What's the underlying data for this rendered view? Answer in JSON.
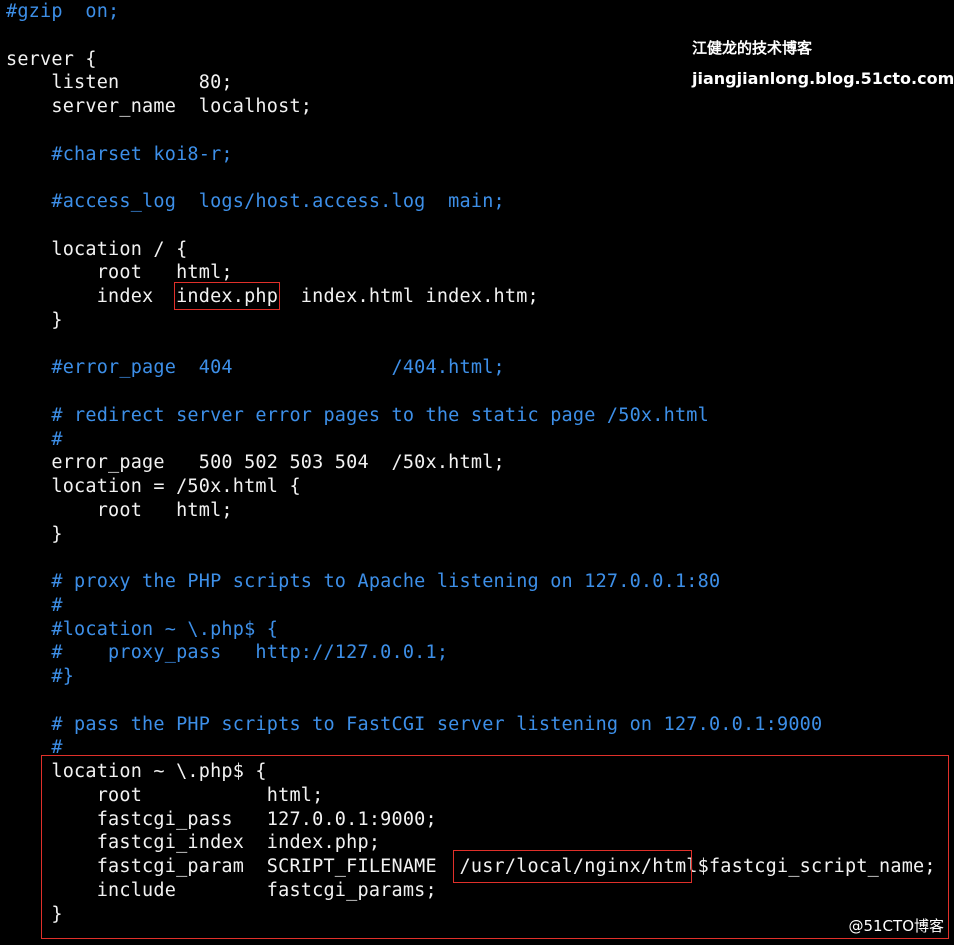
{
  "colors": {
    "background": "#000000",
    "code_text": "#f2f2f2",
    "comment_text": "#3d8fe8",
    "highlight_border": "#e0302a"
  },
  "watermark": {
    "title": "江健龙的技术博客",
    "url": "jiangjianlong.blog.51cto.com",
    "corner": "@51CTO博客"
  },
  "lines": [
    {
      "text": "#gzip  on;",
      "kind": "comment"
    },
    {
      "text": "",
      "kind": "code"
    },
    {
      "text": "server {",
      "kind": "code"
    },
    {
      "text": "    listen       80;",
      "kind": "code"
    },
    {
      "text": "    server_name  localhost;",
      "kind": "code"
    },
    {
      "text": "",
      "kind": "code"
    },
    {
      "text": "    #charset koi8-r;",
      "kind": "comment"
    },
    {
      "text": "",
      "kind": "code"
    },
    {
      "text": "    #access_log  logs/host.access.log  main;",
      "kind": "comment"
    },
    {
      "text": "",
      "kind": "code"
    },
    {
      "text": "    location / {",
      "kind": "code"
    },
    {
      "text": "        root   html;",
      "kind": "code"
    },
    {
      "text": "        index  index.php  index.html index.htm;",
      "kind": "code"
    },
    {
      "text": "    }",
      "kind": "code"
    },
    {
      "text": "",
      "kind": "code"
    },
    {
      "text": "    #error_page  404              /404.html;",
      "kind": "comment"
    },
    {
      "text": "",
      "kind": "code"
    },
    {
      "text": "    # redirect server error pages to the static page /50x.html",
      "kind": "comment"
    },
    {
      "text": "    #",
      "kind": "comment"
    },
    {
      "text": "    error_page   500 502 503 504  /50x.html;",
      "kind": "code"
    },
    {
      "text": "    location = /50x.html {",
      "kind": "code"
    },
    {
      "text": "        root   html;",
      "kind": "code"
    },
    {
      "text": "    }",
      "kind": "code"
    },
    {
      "text": "",
      "kind": "code"
    },
    {
      "text": "    # proxy the PHP scripts to Apache listening on 127.0.0.1:80",
      "kind": "comment"
    },
    {
      "text": "    #",
      "kind": "comment"
    },
    {
      "text": "    #location ~ \\.php$ {",
      "kind": "comment"
    },
    {
      "text": "    #    proxy_pass   http://127.0.0.1;",
      "kind": "comment"
    },
    {
      "text": "    #}",
      "kind": "comment"
    },
    {
      "text": "",
      "kind": "code"
    },
    {
      "text": "    # pass the PHP scripts to FastCGI server listening on 127.0.0.1:9000",
      "kind": "comment"
    },
    {
      "text": "    #",
      "kind": "comment"
    },
    {
      "text": "    location ~ \\.php$ {",
      "kind": "code"
    },
    {
      "text": "        root           html;",
      "kind": "code"
    },
    {
      "text": "        fastcgi_pass   127.0.0.1:9000;",
      "kind": "code"
    },
    {
      "text": "        fastcgi_index  index.php;",
      "kind": "code"
    },
    {
      "text": "        fastcgi_param  SCRIPT_FILENAME  /usr/local/nginx/html$fastcgi_script_name;",
      "kind": "code"
    },
    {
      "text": "        include        fastcgi_params;",
      "kind": "code"
    },
    {
      "text": "    }",
      "kind": "code"
    }
  ]
}
